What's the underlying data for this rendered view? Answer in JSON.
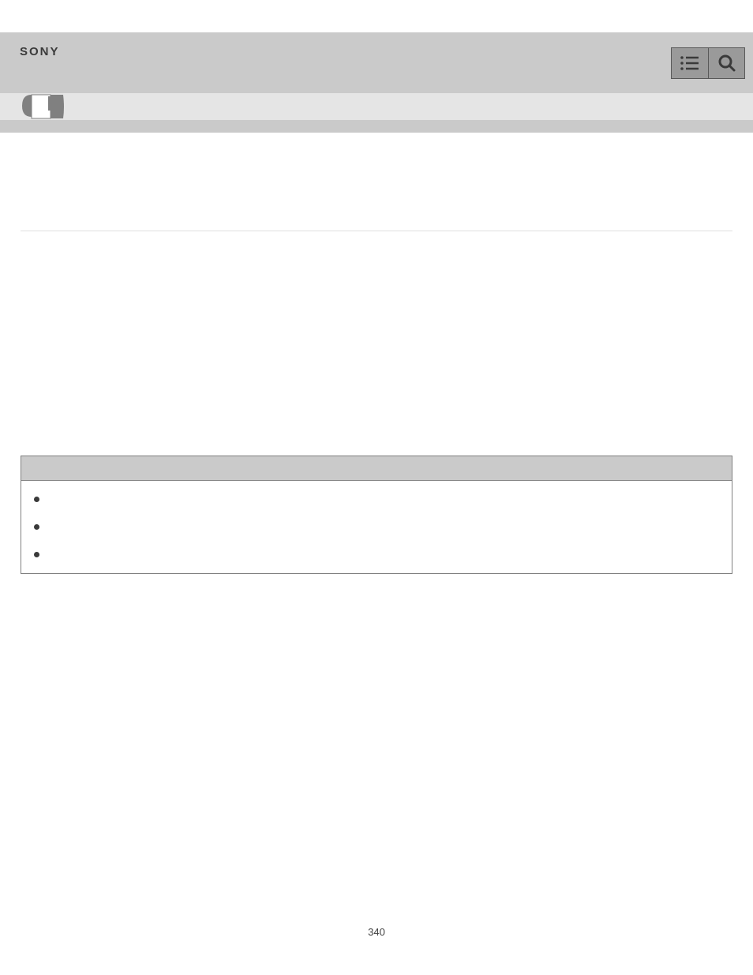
{
  "header": {
    "logo": "SONY"
  },
  "page_number": "340",
  "info_box": {
    "items": [
      "",
      "",
      ""
    ]
  }
}
